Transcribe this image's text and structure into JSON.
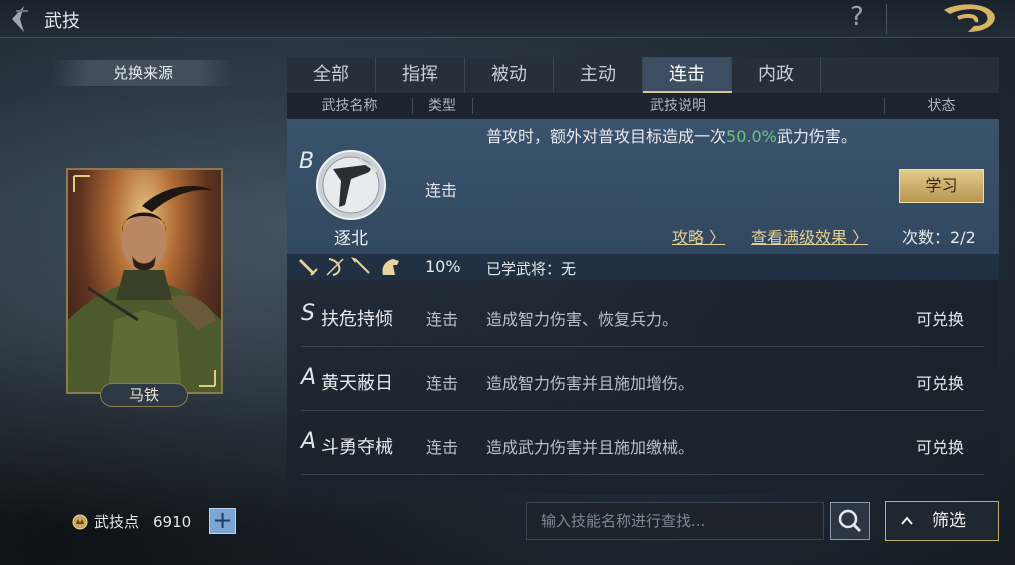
{
  "header": {
    "title": "武技",
    "help": "?"
  },
  "left": {
    "source_label": "兑换来源",
    "general_name": "马铁",
    "points_label": "武技点",
    "points_value": "6910",
    "plus": "+"
  },
  "tabs": [
    {
      "label": "全部",
      "active": false
    },
    {
      "label": "指挥",
      "active": false
    },
    {
      "label": "被动",
      "active": false
    },
    {
      "label": "主动",
      "active": false
    },
    {
      "label": "连击",
      "active": true
    },
    {
      "label": "内政",
      "active": false
    }
  ],
  "columns": {
    "name": "武技名称",
    "type": "类型",
    "desc": "武技说明",
    "status": "状态"
  },
  "selected": {
    "grade": "B",
    "name": "逐北",
    "type": "连击",
    "desc_pre": "普攻时，额外对普攻目标造成一次",
    "desc_value": "50.0%",
    "desc_post": "武力伤害。",
    "learn_label": "学习",
    "guide_label": "攻略 〉",
    "max_label": "查看满级效果 〉",
    "times": "次数：2/2",
    "chance": "10%",
    "learned": "已学武将：无",
    "troop_icons": [
      "infantry-icon",
      "archer-icon",
      "spearman-icon",
      "cavalry-icon"
    ]
  },
  "rows": [
    {
      "grade": "S",
      "name": "扶危持倾",
      "type": "连击",
      "desc": "造成智力伤害、恢复兵力。",
      "status": "可兑换"
    },
    {
      "grade": "A",
      "name": "黄天蔽日",
      "type": "连击",
      "desc": "造成智力伤害并且施加增伤。",
      "status": "可兑换"
    },
    {
      "grade": "A",
      "name": "斗勇夺械",
      "type": "连击",
      "desc": "造成武力伤害并且施加缴械。",
      "status": "可兑换"
    }
  ],
  "search": {
    "placeholder": "输入技能名称进行查找...",
    "value": ""
  },
  "filter_label": "筛选",
  "colors": {
    "accent_gold": "#d9c48a",
    "highlight_green": "#6fc27b",
    "selected_row": "#3a526c"
  }
}
